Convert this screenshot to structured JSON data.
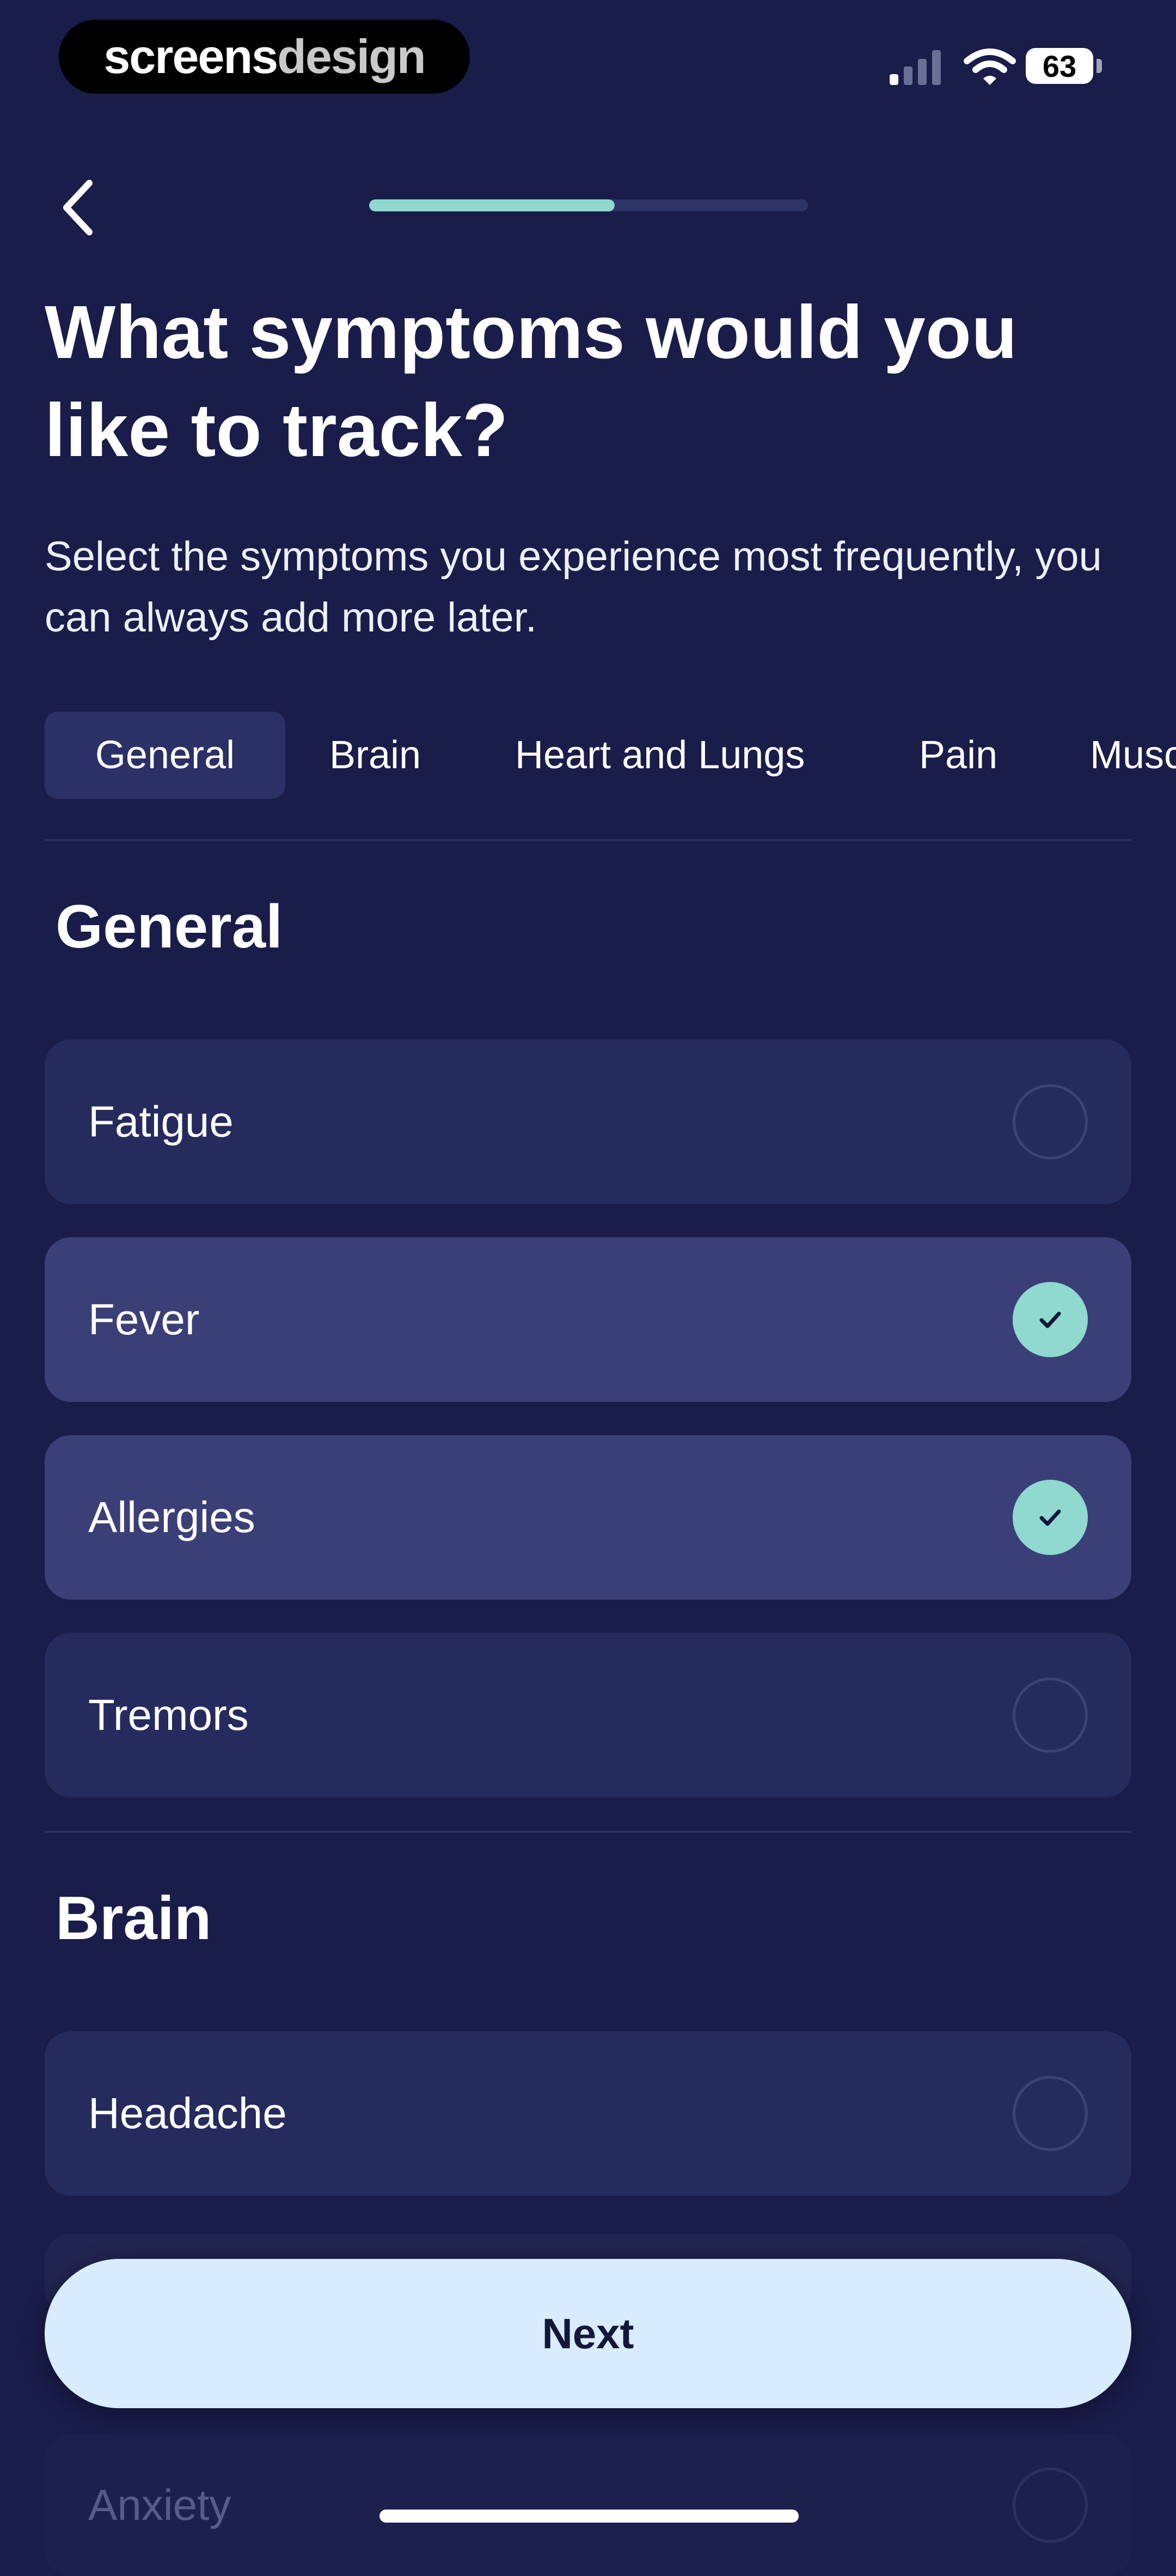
{
  "status_bar": {
    "brand_part1": "screens",
    "brand_part2": "design",
    "battery": "63"
  },
  "progress": {
    "fraction": 0.56
  },
  "header": {
    "title": "What symptoms would you like to track?",
    "subtitle": "Select the symptoms you experience most frequently, you can always add more later."
  },
  "tabs": [
    {
      "label": "General",
      "active": true
    },
    {
      "label": "Brain",
      "active": false
    },
    {
      "label": "Heart and Lungs",
      "active": false
    },
    {
      "label": "Pain",
      "active": false
    },
    {
      "label": "Muscles",
      "active": false
    }
  ],
  "sections": {
    "general": {
      "title": "General",
      "items": [
        {
          "label": "Fatigue",
          "checked": false
        },
        {
          "label": "Fever",
          "checked": true
        },
        {
          "label": "Allergies",
          "checked": true
        },
        {
          "label": "Tremors",
          "checked": false
        }
      ]
    },
    "brain": {
      "title": "Brain",
      "items": [
        {
          "label": "Headache",
          "checked": false
        },
        {
          "label": "Anxiety",
          "checked": false
        }
      ]
    }
  },
  "actions": {
    "next_label": "Next"
  },
  "colors": {
    "background": "#1a1c4a",
    "accent": "#8fd9cf",
    "button": "#d8ecfd"
  }
}
